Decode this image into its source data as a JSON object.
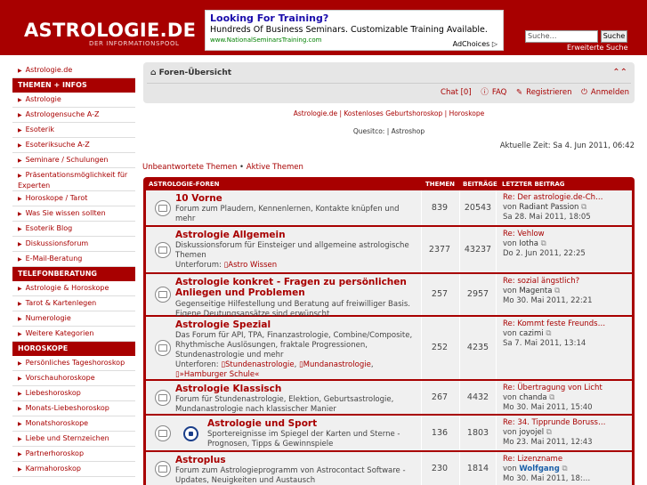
{
  "header": {
    "logo": "ASTROLOGIE.DE",
    "logo_sub": "DER INFORMATIONSPOOL",
    "ad": {
      "title": "Looking For Training?",
      "text": "Hundreds Of Business Seminars. Customizable Training Available.",
      "url": "www.NationalSeminarsTraining.com",
      "choices": "AdChoices ▷"
    },
    "search_placeholder": "Suche…",
    "search_button": "Suche",
    "advanced_search": "Erweiterte Suche"
  },
  "sidebar": {
    "items": [
      {
        "type": "item",
        "label": "Astrologie.de"
      },
      {
        "type": "head",
        "label": "THEMEN + INFOS"
      },
      {
        "type": "item",
        "label": "Astrologie"
      },
      {
        "type": "item",
        "label": "Astrologensuche A-Z"
      },
      {
        "type": "item",
        "label": "Esoterik"
      },
      {
        "type": "item",
        "label": "Esoteriksuche A-Z"
      },
      {
        "type": "item",
        "label": "Seminare / Schulungen"
      },
      {
        "type": "item2",
        "label": "Präsentationsmöglichkeit für Experten"
      },
      {
        "type": "item",
        "label": "Horoskope / Tarot"
      },
      {
        "type": "item",
        "label": "Was Sie wissen sollten"
      },
      {
        "type": "item",
        "label": "Esoterik Blog"
      },
      {
        "type": "item",
        "label": "Diskussionsforum"
      },
      {
        "type": "item",
        "label": "E-Mail-Beratung"
      },
      {
        "type": "head",
        "label": "TELEFONBERATUNG"
      },
      {
        "type": "item",
        "label": "Astrologie & Horoskope"
      },
      {
        "type": "item",
        "label": "Tarot & Kartenlegen"
      },
      {
        "type": "item",
        "label": "Numerologie"
      },
      {
        "type": "item",
        "label": "Weitere Kategorien"
      },
      {
        "type": "head",
        "label": "HOROSKOPE"
      },
      {
        "type": "item",
        "label": "Persönliches Tageshoroskop"
      },
      {
        "type": "item",
        "label": "Vorschauhoroskope"
      },
      {
        "type": "item",
        "label": "Liebeshoroskop"
      },
      {
        "type": "item",
        "label": "Monats-Liebeshoroskop"
      },
      {
        "type": "item",
        "label": "Monatshoroskope"
      },
      {
        "type": "item",
        "label": "Liebe und Sternzeichen"
      },
      {
        "type": "item",
        "label": "Partnerhoroskop"
      },
      {
        "type": "item",
        "label": "Karmahoroskop"
      }
    ]
  },
  "nav": {
    "home": "Foren-Übersicht",
    "collapse_icon": "collapse-icon",
    "chat": "Chat [0]",
    "faq": "FAQ",
    "register": "Registrieren",
    "login": "Anmelden"
  },
  "links1": "Astrologie.de | Kostenloses Geburtshoroskop | Horoskope",
  "links2": "Quesitco:  | Astroshop",
  "time": "Aktuelle Zeit: Sa 4. Jun 2011, 06:42",
  "unanswered": "Unbeantwortete Themen",
  "active": "Aktive Themen",
  "forum_head": {
    "name": "ASTROLOGIE-FOREN",
    "topics": "THEMEN",
    "posts": "BEITRÄGE",
    "last": "LETZTER BEITRAG"
  },
  "forums": [
    {
      "title": "10 Vorne",
      "desc": [
        "Forum zum Plaudern, Kennenlernen, Kontakte knüpfen und mehr"
      ],
      "topics": "839",
      "posts": "20543",
      "last_title": "Re: Der astrologie.de-Ch…",
      "last_by": "von",
      "last_author": "Radiant Passion",
      "last_date": "Sa 28. Mai 2011, 18:05"
    },
    {
      "title": "Astrologie Allgemein",
      "desc": [
        "Diskussionsforum für Einsteiger und allgemeine astrologische",
        "Themen"
      ],
      "sub_label": "Unterforum:",
      "subs": [
        "Astro Wissen"
      ],
      "topics": "2377",
      "posts": "43237",
      "last_title": "Re: Vehlow",
      "last_by": "von",
      "last_author": "Iotha",
      "last_date": "Do 2. Jun 2011, 22:25"
    },
    {
      "title1": "Astrologie konkret - Fragen zu persönlichen",
      "title2": "Anliegen und Problemen",
      "desc": [
        "Gegenseitige Hilfestellung und Beratung auf freiwilliger Basis.",
        "Eigene Deutungsansätze sind erwünscht"
      ],
      "topics": "257",
      "posts": "2957",
      "last_title": "Re: sozial ängstlich?",
      "last_by": "von",
      "last_author": "Magenta",
      "last_date": "Mo 30. Mai 2011, 22:21"
    },
    {
      "title": "Astrologie Spezial",
      "desc": [
        "Das Forum für API, TPA, Finanzastrologie, Combine/Composite,",
        "Rhythmische Auslösungen, fraktale Progressionen,",
        "Stundenastrologie und mehr"
      ],
      "sub_label": "Unterforen:",
      "subs": [
        "Stundenastrologie",
        "Mundanastrologie",
        "»Hamburger Schule«"
      ],
      "topics": "252",
      "posts": "4235",
      "last_title": "Re: Kommt feste Freunds…",
      "last_by": "von",
      "last_author": "cazimi",
      "last_date": "Sa 7. Mai 2011, 13:14"
    },
    {
      "title": "Astrologie Klassisch",
      "desc": [
        "Forum für Stundenastrologie, Elektion, Geburtsastrologie,",
        "Mundanastrologie nach klassischer Manier"
      ],
      "topics": "267",
      "posts": "4432",
      "last_title": "Re: Übertragung von Licht",
      "last_by": "von",
      "last_author": "chanda",
      "last_date": "Mo 30. Mai 2011, 15:40"
    },
    {
      "title": "Astrologie und Sport",
      "desc": [
        "Sportereignisse im Spiegel der Karten und Sterne -",
        "Prognosen, Tipps & Gewinnspiele"
      ],
      "topics": "136",
      "posts": "1803",
      "last_title": "Re: 34. Tipprunde Boruss…",
      "last_by": "von",
      "last_author": "joyojel",
      "last_date": "Mo 23. Mai 2011, 12:43"
    },
    {
      "title": "Astroplus",
      "desc": [
        "Forum zum Astrologieprogramm von Astrocontact Software -",
        "Updates, Neuigkeiten und Austausch"
      ],
      "topics": "230",
      "posts": "1814",
      "last_title": "Re: Lizenzname",
      "last_by": "von",
      "last_author": "Wolfgang",
      "last_date": "Mo 30. Mai 2011, 18:…"
    }
  ]
}
